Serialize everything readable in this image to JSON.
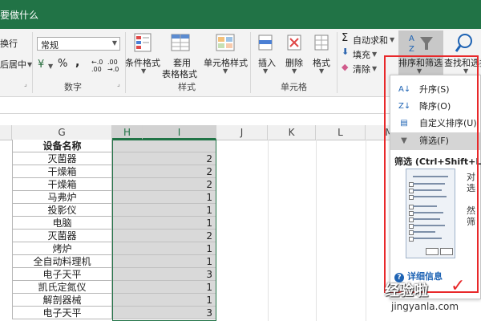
{
  "title_text": "要做什么",
  "ribbon": {
    "wrap_text": "换行",
    "merge_center": "后居中",
    "number_format": "常规",
    "percent": "%",
    "comma": ",",
    "currency": "¥",
    "dec_inc": "←.0 .00",
    "dec_dec": ".00 →.0",
    "cond_format": "条件格式",
    "table_format_1": "套用",
    "table_format_2": "表格格式",
    "cell_style": "单元格样式",
    "insert": "插入",
    "delete": "删除",
    "format": "格式",
    "autosum": "自动求和",
    "fill": "填充",
    "clear": "清除",
    "sort_filter": "排序和筛选",
    "find_select": "查找和选择",
    "group_number": "数字",
    "group_styles": "样式",
    "group_cells": "单元格"
  },
  "columns": [
    "G",
    "H",
    "I",
    "J",
    "K",
    "L",
    "M"
  ],
  "rows": [
    {
      "name": "设备名称",
      "count": ""
    },
    {
      "name": "灭菌器",
      "count": "2"
    },
    {
      "name": "干燥箱",
      "count": "2"
    },
    {
      "name": "干燥箱",
      "count": "2"
    },
    {
      "name": "马弗炉",
      "count": "1"
    },
    {
      "name": "投影仪",
      "count": "1"
    },
    {
      "name": "电脑",
      "count": "1"
    },
    {
      "name": "灭菌器",
      "count": "2"
    },
    {
      "name": "烤炉",
      "count": "1"
    },
    {
      "name": "全自动料理机",
      "count": "1"
    },
    {
      "name": "电子天平",
      "count": "3"
    },
    {
      "name": "凯氏定氮仪",
      "count": "1"
    },
    {
      "name": "解剖器械",
      "count": "1"
    },
    {
      "name": "电子天平",
      "count": "3"
    }
  ],
  "menu": {
    "asc": "升序(S)",
    "desc": "降序(O)",
    "custom": "自定义排序(U)...",
    "filter": "筛选(F)",
    "tip_title": "筛选 (Ctrl+Shift+L)",
    "tip_right_1": "对",
    "tip_right_2": "选",
    "tip_right_3": "然",
    "tip_right_4": "筛",
    "more_info": "详细信息"
  },
  "watermark": {
    "line1": "经验啦",
    "check": "✓",
    "line2": "jingyanla.com"
  },
  "colors": {
    "title_green": "#217346",
    "highlight_red": "#e8282a",
    "link_blue": "#1e63b4",
    "selection_gray": "#d9d9d9"
  }
}
